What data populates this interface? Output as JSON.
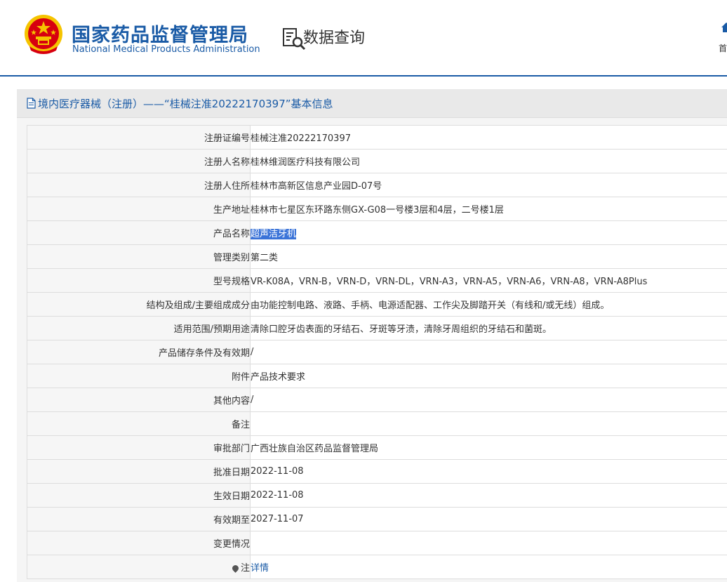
{
  "header": {
    "org_name_cn": "国家药品监督管理局",
    "org_name_en": "National Medical Products Administration",
    "query_title": "数据查询",
    "home_label": "首页"
  },
  "panel": {
    "title": "境内医疗器械（注册）——“桂械注准20222170397”基本信息"
  },
  "rows": [
    {
      "label": "注册证编号",
      "value": "桂械注准20222170397"
    },
    {
      "label": "注册人名称",
      "value": "桂林维润医疗科技有限公司"
    },
    {
      "label": "注册人住所",
      "value": "桂林市高新区信息产业园D-07号"
    },
    {
      "label": "生产地址",
      "value": "桂林市七星区东环路东侧GX-G08一号楼3层和4层，二号楼1层"
    },
    {
      "label": "产品名称",
      "value": "超声洁牙机"
    },
    {
      "label": "管理类别",
      "value": "第二类"
    },
    {
      "label": "型号规格",
      "value": "VR-K08A，VRN-B，VRN-D，VRN-DL，VRN-A3，VRN-A5，VRN-A6，VRN-A8，VRN-A8Plus"
    },
    {
      "label": "结构及组成/主要组成成分",
      "value": "由功能控制电路、液路、手柄、电源适配器、工作尖及脚踏开关（有线和/或无线）组成。"
    },
    {
      "label": "适用范围/预期用途",
      "value": "清除口腔牙齿表面的牙结石、牙斑等牙渍，清除牙周组织的牙结石和菌斑。"
    },
    {
      "label": "产品储存条件及有效期",
      "value": "/"
    },
    {
      "label": "附件",
      "value": "产品技术要求"
    },
    {
      "label": "其他内容",
      "value": "/"
    },
    {
      "label": "备注",
      "value": ""
    },
    {
      "label": "审批部门",
      "value": "广西壮族自治区药品监督管理局"
    },
    {
      "label": "批准日期",
      "value": "2022-11-08"
    },
    {
      "label": "生效日期",
      "value": "2022-11-08"
    },
    {
      "label": "有效期至",
      "value": "2027-11-07"
    },
    {
      "label": "变更情况",
      "value": ""
    },
    {
      "label": "注",
      "value": "详情"
    }
  ],
  "colors": {
    "brand_blue": "#1a5ba6",
    "selection_highlight": "#3a73d8",
    "emblem_red": "#d7000f",
    "emblem_gold": "#f5c400"
  },
  "icons": {
    "emblem": "national-emblem",
    "query": "document-search-icon",
    "home": "home-icon",
    "panel": "document-icon",
    "note": "pin-icon"
  }
}
